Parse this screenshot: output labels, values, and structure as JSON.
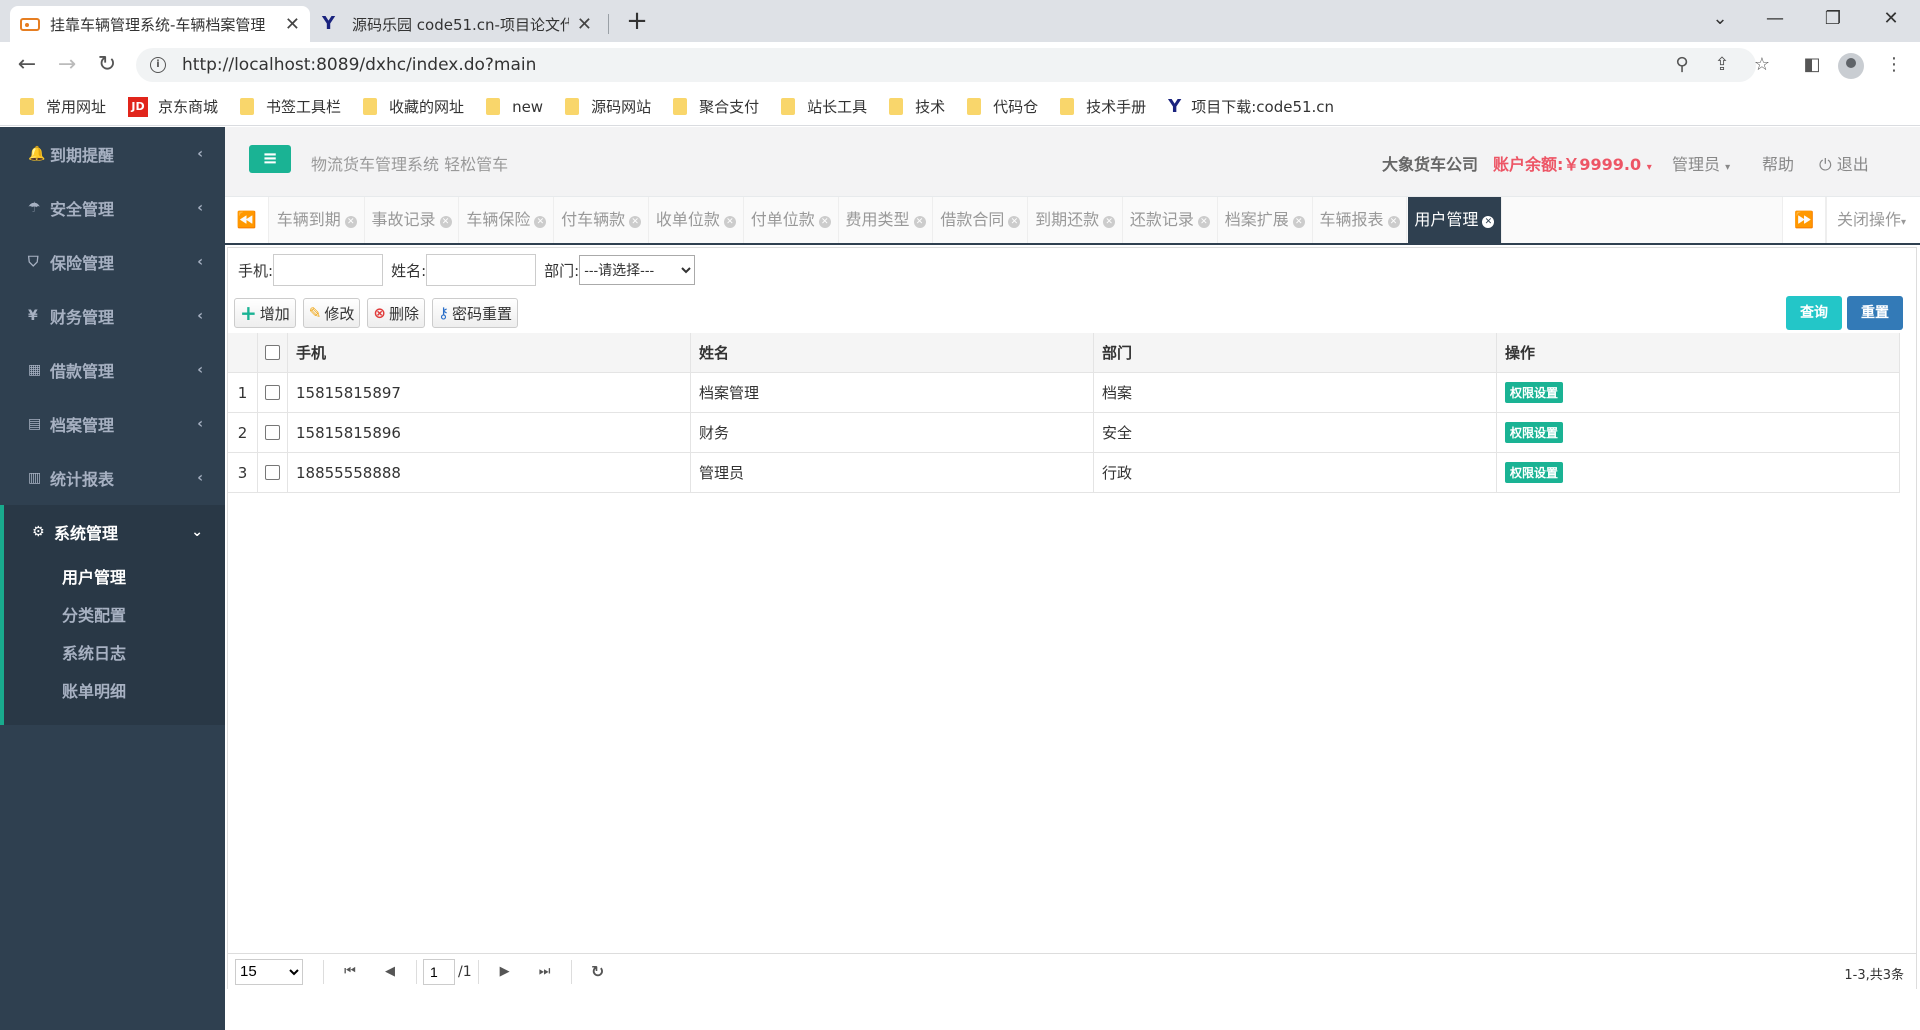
{
  "browser": {
    "tabs": [
      {
        "title": "挂靠车辆管理系统-车辆档案管理",
        "active": true
      },
      {
        "title": "源码乐园 code51.cn-项目论文代",
        "active": false
      }
    ],
    "new_tab": "+",
    "url": "http://localhost:8089/dxhc/index.do?main",
    "bookmarks": [
      {
        "label": "常用网址",
        "icon": "folder-icon"
      },
      {
        "label": "京东商城",
        "icon": "jd-icon",
        "icon_text": "JD"
      },
      {
        "label": "书签工具栏",
        "icon": "folder-icon"
      },
      {
        "label": "收藏的网址",
        "icon": "folder-icon"
      },
      {
        "label": "new",
        "icon": "folder-icon"
      },
      {
        "label": "源码网站",
        "icon": "folder-icon"
      },
      {
        "label": "聚合支付",
        "icon": "folder-icon"
      },
      {
        "label": "站长工具",
        "icon": "folder-icon"
      },
      {
        "label": "技术",
        "icon": "folder-icon"
      },
      {
        "label": "代码仓",
        "icon": "folder-icon"
      },
      {
        "label": "技术手册",
        "icon": "folder-icon"
      },
      {
        "label": "项目下载:code51.cn",
        "icon": "y-logo-icon",
        "icon_text": "Y"
      }
    ]
  },
  "sidebar": {
    "menus": [
      {
        "label": "到期提醒",
        "icon": "bell-icon",
        "glyph": "🔔"
      },
      {
        "label": "安全管理",
        "icon": "umbrella-icon",
        "glyph": "☂"
      },
      {
        "label": "保险管理",
        "icon": "shield-icon",
        "glyph": "⛉"
      },
      {
        "label": "财务管理",
        "icon": "yen-icon",
        "glyph": "¥"
      },
      {
        "label": "借款管理",
        "icon": "calculator-icon",
        "glyph": "▦"
      },
      {
        "label": "档案管理",
        "icon": "file-icon",
        "glyph": "▤"
      },
      {
        "label": "统计报表",
        "icon": "bar-chart-icon",
        "glyph": "▥"
      }
    ],
    "open_menu": {
      "label": "系统管理",
      "icon": "gear-icon",
      "glyph": "⚙"
    },
    "sub_items": [
      "用户管理",
      "分类配置",
      "系统日志",
      "账单明细"
    ]
  },
  "header": {
    "slogan": "物流货车管理系统 轻松管车",
    "company": "大象货车公司",
    "balance": "账户余额:￥9999.0",
    "admin": "管理员",
    "help": "帮助",
    "logout": "退出",
    "colors": {
      "accent": "#1ab394",
      "dark": "#2f4050",
      "danger": "#ed5565",
      "primary": "#337ab7",
      "info": "#23c6c8"
    }
  },
  "content_tabs": {
    "tabs": [
      "车辆到期",
      "事故记录",
      "车辆保险",
      "付车辆款",
      "收单位款",
      "付单位款",
      "费用类型",
      "借款合同",
      "到期还款",
      "还款记录",
      "档案扩展",
      "车辆报表",
      "用户管理"
    ],
    "active": "用户管理",
    "close_ops": "关闭操作"
  },
  "search": {
    "phone_label": "手机:",
    "phone_value": "",
    "name_label": "姓名:",
    "name_value": "",
    "dept_label": "部门:",
    "dept_selected": "---请选择---"
  },
  "toolbar": {
    "add": "增加",
    "edit": "修改",
    "delete": "删除",
    "reset_pwd": "密码重置",
    "query": "查询",
    "reset": "重置"
  },
  "grid": {
    "columns": [
      "手机",
      "姓名",
      "部门",
      "操作"
    ],
    "rows": [
      {
        "num": "1",
        "phone": "15815815897",
        "name": "档案管理",
        "dept": "档案",
        "op": "权限设置"
      },
      {
        "num": "2",
        "phone": "15815815896",
        "name": "财务",
        "dept": "安全",
        "op": "权限设置"
      },
      {
        "num": "3",
        "phone": "18855558888",
        "name": "管理员",
        "dept": "行政",
        "op": "权限设置"
      }
    ]
  },
  "pager": {
    "page_size": "15",
    "page": "1",
    "pages": "/1",
    "summary": "1-3,共3条"
  }
}
